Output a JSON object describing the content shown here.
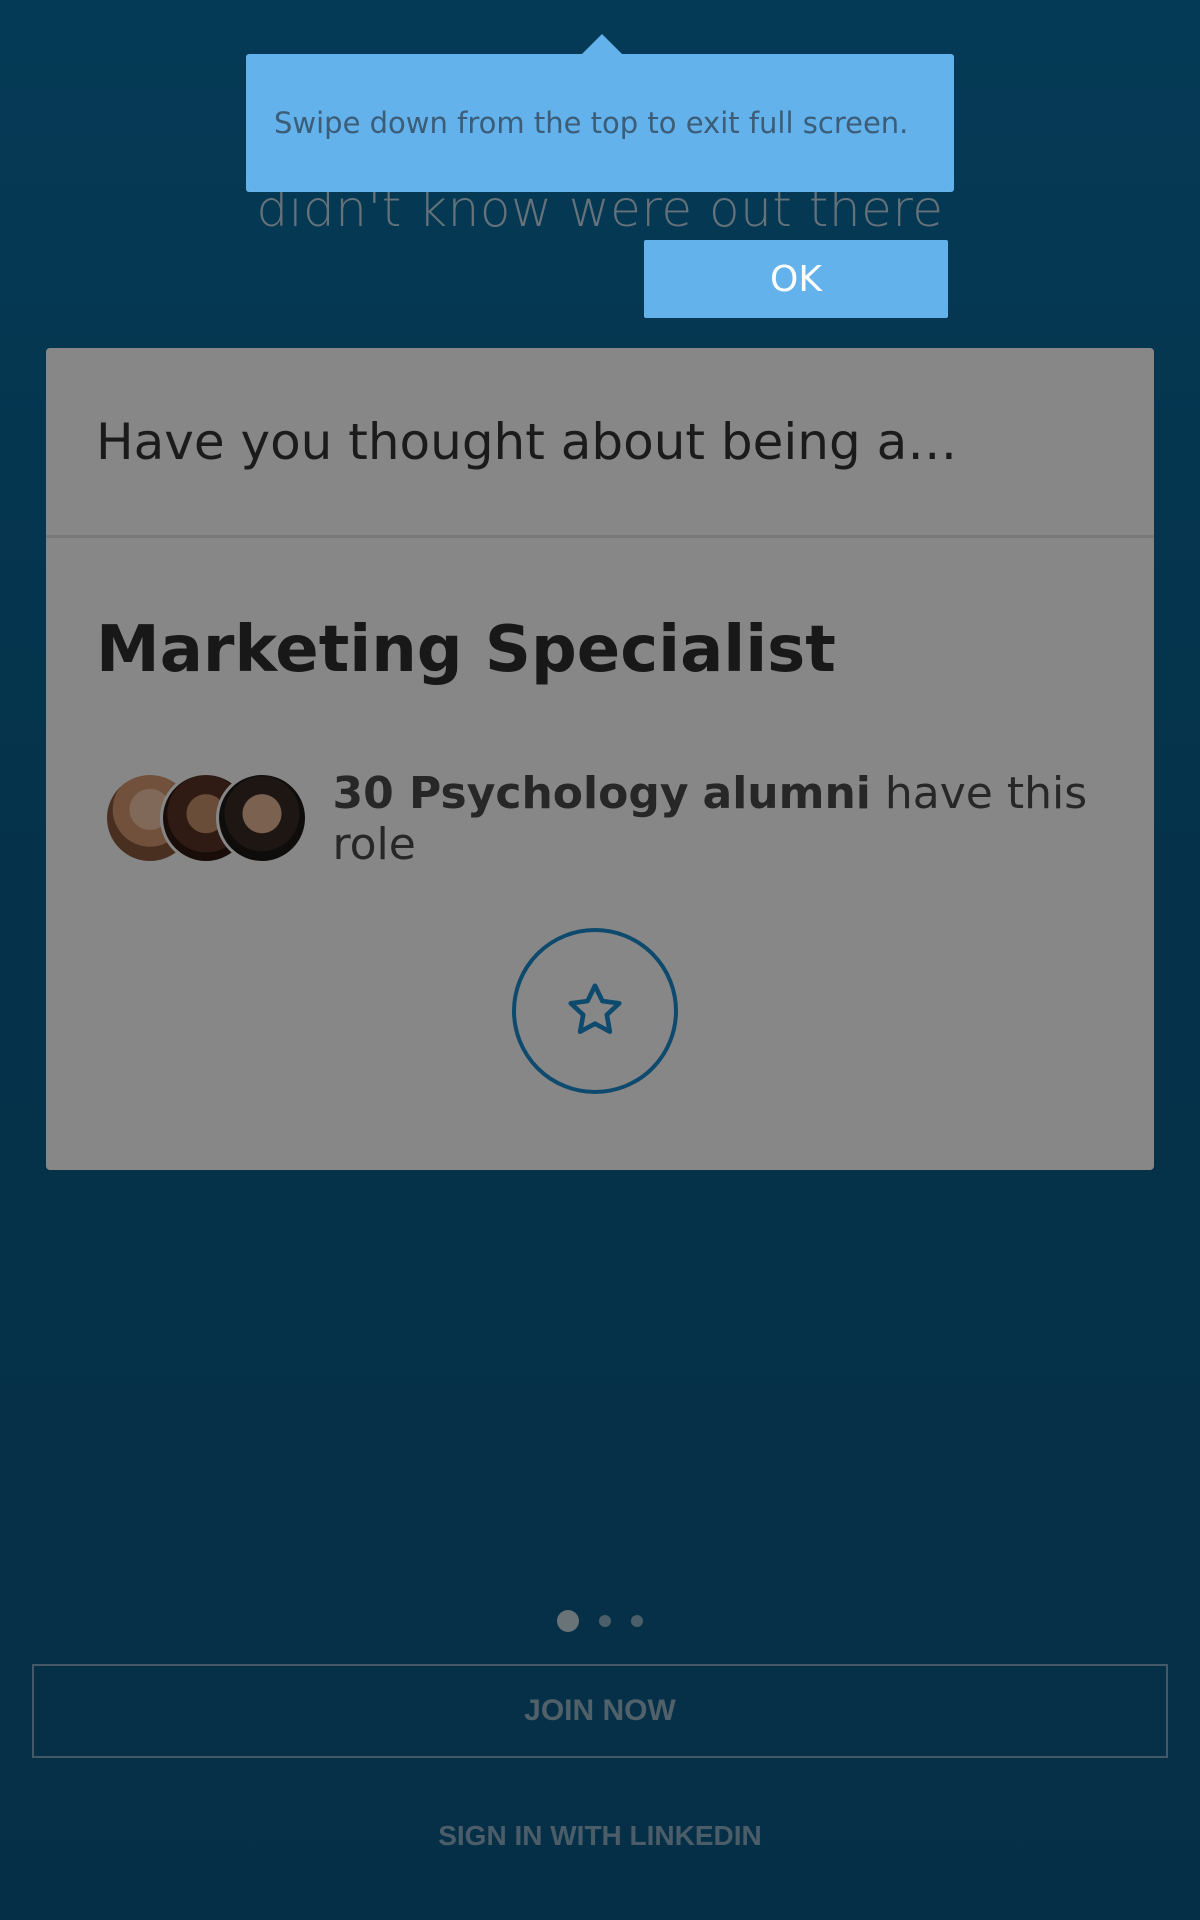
{
  "intro": {
    "headline": "didn't know were out there"
  },
  "card": {
    "question": "Have you thought about being a…",
    "role_title": "Marketing Specialist",
    "alumni": {
      "count_field": "30 Psychology",
      "bold_word": "alumni",
      "suffix": "have this role"
    },
    "avatar_icons": [
      "person-avatar",
      "person-avatar",
      "person-avatar"
    ],
    "star_icon": "star-outline-icon",
    "accent_color": "#1a8ccf"
  },
  "pager": {
    "total": 3,
    "active_index": 0
  },
  "actions": {
    "join_label": "JOIN NOW",
    "signin_label": "SIGN IN WITH LINKEDIN"
  },
  "tooltip": {
    "message": "Swipe down from the top to exit full screen.",
    "ok_label": "OK",
    "color": "#63b2ec"
  }
}
